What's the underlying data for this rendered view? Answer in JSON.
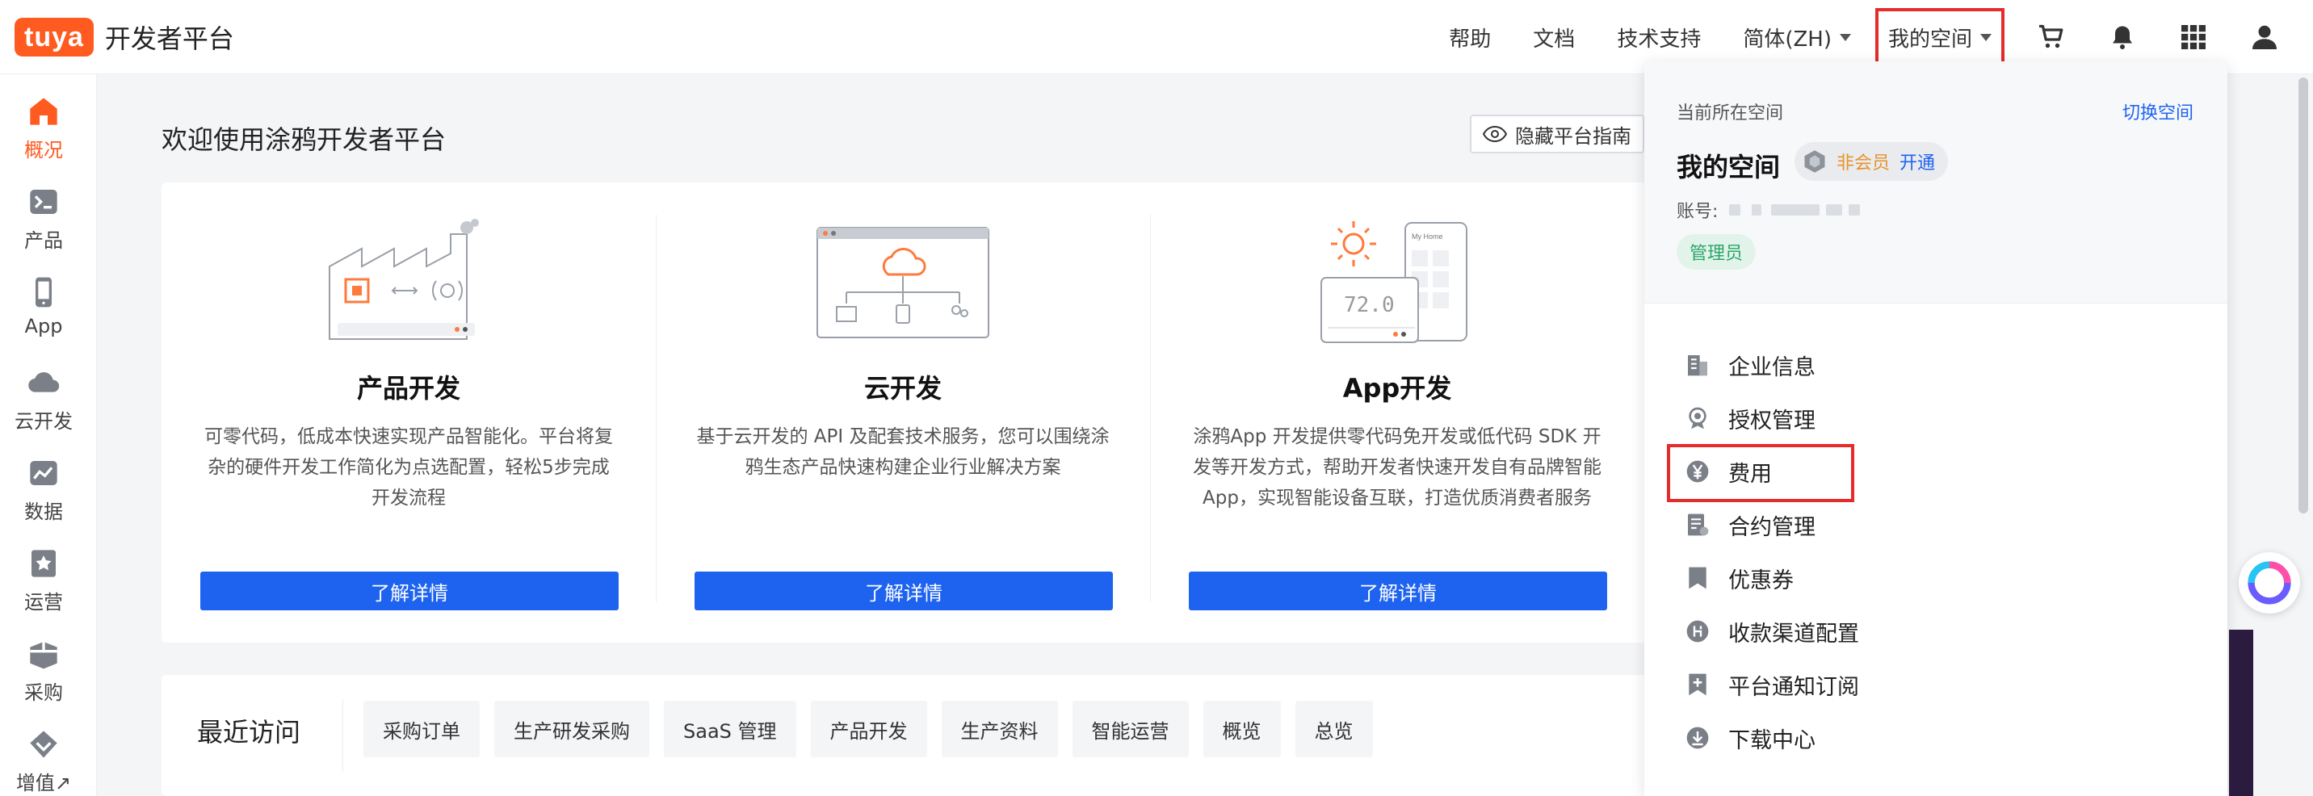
{
  "header": {
    "logo_badge": "tuya",
    "logo_text": "开发者平台",
    "nav": {
      "help": "帮助",
      "docs": "文档",
      "support": "技术支持",
      "language": "简体(ZH)",
      "my_space": "我的空间"
    },
    "icons": [
      "cart-icon",
      "bell-icon",
      "apps-grid-icon",
      "user-icon"
    ]
  },
  "sidebar": {
    "items": [
      {
        "label": "概况",
        "icon": "home-icon",
        "active": true
      },
      {
        "label": "产品",
        "icon": "terminal-icon"
      },
      {
        "label": "App",
        "icon": "phone-icon"
      },
      {
        "label": "云开发",
        "icon": "cloud-icon"
      },
      {
        "label": "数据",
        "icon": "chart-icon"
      },
      {
        "label": "运营",
        "icon": "star-badge-icon"
      },
      {
        "label": "采购",
        "icon": "box-icon"
      },
      {
        "label": "增值↗",
        "icon": "diamond-icon"
      }
    ]
  },
  "main": {
    "title": "欢迎使用涂鸦开发者平台",
    "hide_guide": "隐藏平台指南",
    "cards": [
      {
        "title": "产品开发",
        "desc": "可零代码，低成本快速实现产品智能化。平台将复杂的硬件开发工作简化为点选配置，轻松5步完成开发流程",
        "button": "了解详情"
      },
      {
        "title": "云开发",
        "desc": "基于云开发的 API 及配套技术服务，您可以围绕涂鸦生态产品快速构建企业行业解决方案",
        "button": "了解详情"
      },
      {
        "title": "App开发",
        "desc": "涂鸦App 开发提供零代码免开发或低代码 SDK 开发等开发方式，帮助开发者快速开发自有品牌智能 App，实现智能设备互联，打造优质消费者服务",
        "button": "了解详情",
        "illus_temp": "72.0",
        "illus_phone": "My Home"
      }
    ],
    "recent": {
      "title": "最近访问",
      "tags": [
        "采购订单",
        "生产研发采购",
        "SaaS 管理",
        "产品开发",
        "生产资料",
        "智能运营",
        "概览",
        "总览"
      ]
    }
  },
  "dropdown": {
    "current_label": "当前所在空间",
    "switch": "切换空间",
    "space_name": "我的空间",
    "member_status": "非会员",
    "open": "开通",
    "account_label": "账号:",
    "role": "管理员",
    "menu": [
      {
        "label": "企业信息",
        "icon": "building-icon"
      },
      {
        "label": "授权管理",
        "icon": "award-icon"
      },
      {
        "label": "费用",
        "icon": "yen-icon"
      },
      {
        "label": "合约管理",
        "icon": "contract-icon"
      },
      {
        "label": "优惠券",
        "icon": "coupon-icon"
      },
      {
        "label": "收款渠道配置",
        "icon": "payment-channel-icon"
      },
      {
        "label": "平台通知订阅",
        "icon": "subscribe-icon"
      },
      {
        "label": "下载中心",
        "icon": "download-icon"
      }
    ]
  },
  "colors": {
    "brand_orange": "#ff5a1f",
    "primary_blue": "#1e63f0",
    "highlight_red": "#e52b2b",
    "role_green": "#2ca56a"
  }
}
